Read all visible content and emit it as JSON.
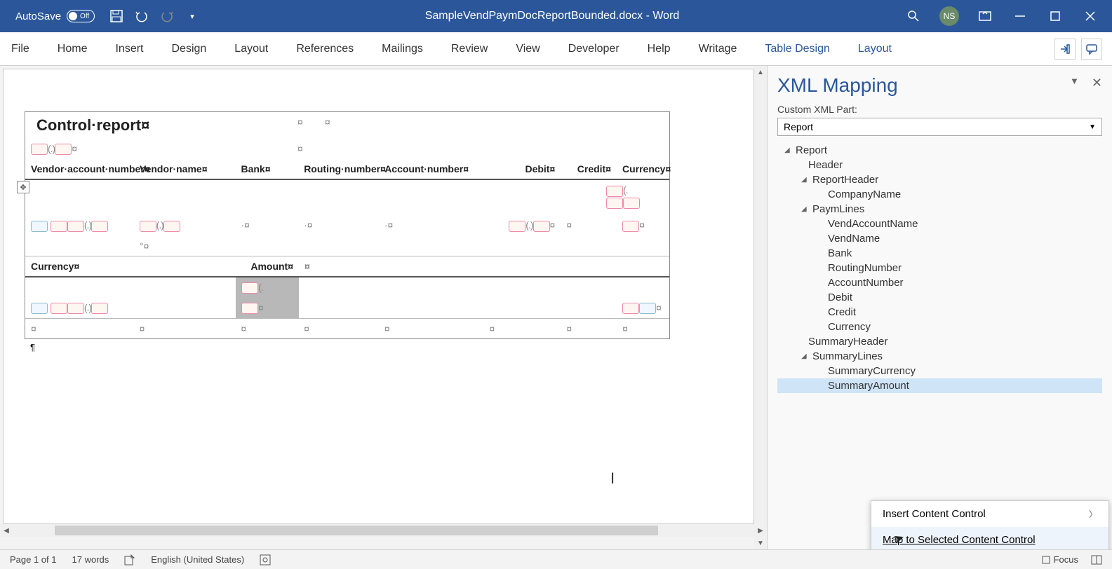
{
  "titlebar": {
    "autosave_label": "AutoSave",
    "autosave_state": "Off",
    "doc_title": "SampleVendPaymDocReportBounded.docx - Word",
    "user_initials": "NS"
  },
  "ribbon": {
    "tabs": [
      "File",
      "Home",
      "Insert",
      "Design",
      "Layout",
      "References",
      "Mailings",
      "Review",
      "View",
      "Developer",
      "Help",
      "Writage"
    ],
    "context_tabs": [
      "Table Design",
      "Layout"
    ]
  },
  "document": {
    "title": "Control·report¤",
    "col_headers": [
      "Vendor·account·number¤",
      "Vendor·name¤",
      "Bank¤",
      "Routing·number¤",
      "Account·number¤",
      "Debit¤",
      "Credit¤",
      "Currency¤"
    ],
    "sum_headers": [
      "Currency¤",
      "Amount¤"
    ]
  },
  "xml_pane": {
    "title": "XML Mapping",
    "part_label": "Custom XML Part:",
    "selected_part": "Report",
    "tree": {
      "root": "Report",
      "header": "Header",
      "report_header": "ReportHeader",
      "company_name": "CompanyName",
      "paym_lines": "PaymLines",
      "vend_account_name": "VendAccountName",
      "vend_name": "VendName",
      "bank": "Bank",
      "routing_number": "RoutingNumber",
      "account_number": "AccountNumber",
      "debit": "Debit",
      "credit": "Credit",
      "currency": "Currency",
      "summary_header": "SummaryHeader",
      "summary_lines": "SummaryLines",
      "summary_currency": "SummaryCurrency",
      "summary_amount": "SummaryAmount"
    },
    "context_menu": {
      "insert": "Insert Content Control",
      "map": "Map to Selected Content Control"
    }
  },
  "statusbar": {
    "page": "Page 1 of 1",
    "words": "17 words",
    "language": "English (United States)",
    "focus": "Focus"
  }
}
